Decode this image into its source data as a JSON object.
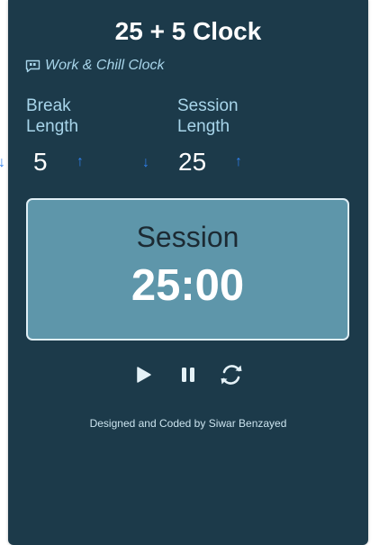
{
  "app": {
    "title": "25 + 5 Clock",
    "subtitle": "Work & Chill Clock",
    "subtitle_icon": "quote-bubble-icon"
  },
  "break": {
    "label_line1": "Break",
    "label_line2": "Length",
    "value": "5",
    "decrement_icon": "↓",
    "increment_icon": "↑"
  },
  "session": {
    "label_line1": "Session",
    "label_line2": "Length",
    "value": "25",
    "decrement_icon": "↓",
    "increment_icon": "↑"
  },
  "timer": {
    "label": "Session",
    "time": "25:00"
  },
  "controls": [
    "play-icon",
    "pause-icon",
    "reset-icon"
  ],
  "footer": {
    "credit": "Designed and Coded by Siwar Benzayed"
  },
  "colors": {
    "card_bg": "#1c3a4a",
    "timer_bg": "#5e96aa",
    "accent_arrow": "#2f80ed",
    "label_text": "#a8d5ea"
  }
}
